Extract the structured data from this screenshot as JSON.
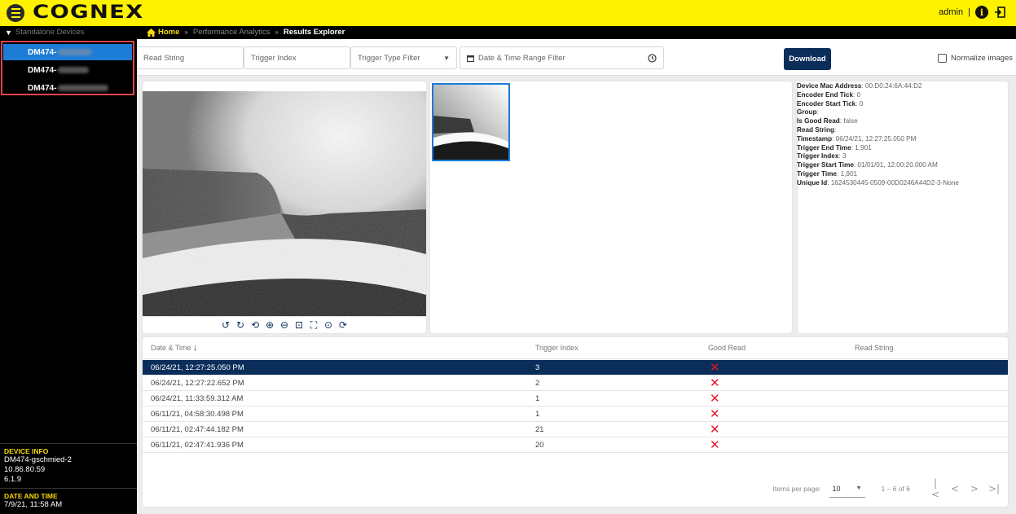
{
  "app": {
    "logo": "COGNEX",
    "user": "admin",
    "user_sep": "|"
  },
  "breadcrumb": {
    "section": "Standalone Devices",
    "home": "Home",
    "items": [
      "Performance Analytics",
      "Results Explorer"
    ]
  },
  "sidebar": {
    "devices": [
      {
        "label": "DM474-",
        "selected": true
      },
      {
        "label": "DM474-",
        "selected": false
      },
      {
        "label": "DM474-",
        "selected": false
      }
    ],
    "device_info": {
      "title": "DEVICE INFO",
      "name": "DM474-gschmied-2",
      "ip": "10.86.80.59",
      "version": "6.1.9"
    },
    "date_time": {
      "title": "DATE AND TIME",
      "value": "7/9/21, 11:58 AM"
    }
  },
  "filters": {
    "read_string": "Read String",
    "trigger_index": "Trigger Index",
    "trigger_type": "Trigger Type Filter",
    "date_range": "Date & Time Range Filter",
    "download": "Download",
    "normalize": "Normalize images"
  },
  "metadata": [
    {
      "key": "Device Mac Address",
      "value": "00:D0:24:6A:44:D2"
    },
    {
      "key": "Encoder End Tick",
      "value": "0"
    },
    {
      "key": "Encoder Start Tick",
      "value": "0"
    },
    {
      "key": "Group",
      "value": ""
    },
    {
      "key": "Is Good Read",
      "value": "false"
    },
    {
      "key": "Read String",
      "value": ""
    },
    {
      "key": "Timestamp",
      "value": "06/24/21, 12:27:25.050 PM"
    },
    {
      "key": "Trigger End Time",
      "value": "1,901"
    },
    {
      "key": "Trigger Index",
      "value": "3"
    },
    {
      "key": "Trigger Start Time",
      "value": "01/01/01, 12:00:20.000 AM"
    },
    {
      "key": "Trigger Time",
      "value": "1,901"
    },
    {
      "key": "Unique Id",
      "value": "1624530445-0509-00D0246A44D2-3-None"
    }
  ],
  "table": {
    "columns": [
      "Date & Time",
      "Trigger Index",
      "Good Read",
      "Read String"
    ],
    "sort_icon": "arrow-down-icon",
    "rows": [
      {
        "datetime": "06/24/21, 12:27:25.050 PM",
        "trigger": "3",
        "good": "✕",
        "read": "",
        "selected": true
      },
      {
        "datetime": "06/24/21, 12:27:22.652 PM",
        "trigger": "2",
        "good": "✕",
        "read": "",
        "selected": false
      },
      {
        "datetime": "06/24/21, 11:33:59.312 AM",
        "trigger": "1",
        "good": "✕",
        "read": "",
        "selected": false
      },
      {
        "datetime": "06/11/21, 04:58:30.498 PM",
        "trigger": "1",
        "good": "✕",
        "read": "",
        "selected": false
      },
      {
        "datetime": "06/11/21, 02:47:44.182 PM",
        "trigger": "21",
        "good": "✕",
        "read": "",
        "selected": false
      },
      {
        "datetime": "06/11/21, 02:47:41.936 PM",
        "trigger": "20",
        "good": "✕",
        "read": "",
        "selected": false
      }
    ],
    "items_per_page_label": "Items per page:",
    "items_per_page": "10",
    "range": "1 – 6 of 6"
  },
  "colors": {
    "brand_yellow": "#fff200",
    "nav_dark": "#0b2d5a",
    "select_blue": "#1c7cd6",
    "error_red": "#e3182d"
  }
}
